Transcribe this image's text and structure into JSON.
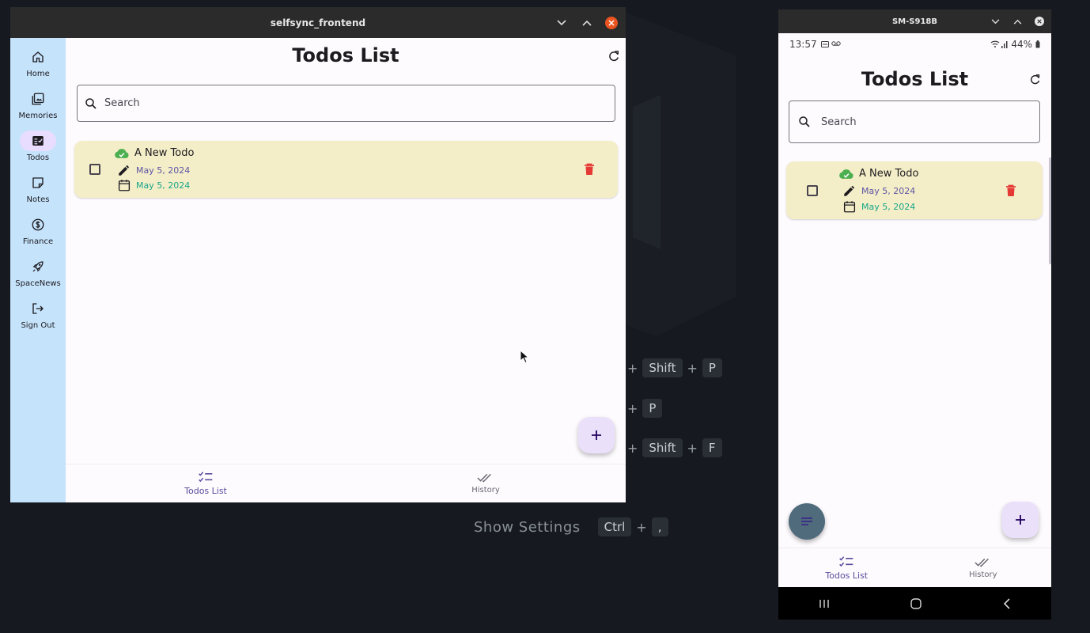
{
  "background": {
    "shortcuts": [
      {
        "keys": [
          "Shift",
          "P"
        ]
      },
      {
        "keys": [
          "P"
        ]
      },
      {
        "keys": [
          "Shift",
          "F"
        ]
      }
    ],
    "show_settings": {
      "label": "Show Settings",
      "keys": [
        "Ctrl",
        ","
      ]
    },
    "plus": "+"
  },
  "desktop": {
    "window_title": "selfsync_frontend",
    "rail": [
      {
        "label": "Home",
        "icon": "home-icon"
      },
      {
        "label": "Memories",
        "icon": "photo-library-icon"
      },
      {
        "label": "Todos",
        "icon": "fact-check-icon",
        "active": true
      },
      {
        "label": "Notes",
        "icon": "note-icon"
      },
      {
        "label": "Finance",
        "icon": "dollar-icon"
      },
      {
        "label": "SpaceNews",
        "icon": "rocket-icon"
      },
      {
        "label": "Sign Out",
        "icon": "logout-icon"
      }
    ],
    "page_title": "Todos List",
    "search_placeholder": "Search",
    "todos": [
      {
        "title": "A New Todo",
        "edited": "May 5, 2024",
        "due": "May 5, 2024",
        "synced": true,
        "completed": false
      }
    ],
    "bottom_nav": [
      {
        "label": "Todos List",
        "icon": "checklist-icon",
        "active": true
      },
      {
        "label": "History",
        "icon": "done-all-icon",
        "active": false
      }
    ]
  },
  "phone": {
    "window_title": "SM-S918B",
    "status_time": "13:57",
    "battery": "44%",
    "page_title": "Todos List",
    "search_placeholder": "Search",
    "todos": [
      {
        "title": "A New Todo",
        "edited": "May 5, 2024",
        "due": "May 5, 2024",
        "synced": true,
        "completed": false
      }
    ],
    "bottom_nav": [
      {
        "label": "Todos List",
        "icon": "checklist-icon",
        "active": true
      },
      {
        "label": "History",
        "icon": "done-all-icon",
        "active": false
      }
    ]
  },
  "colors": {
    "rail_bg": "#c5e3fb",
    "card_bg": "#f4eec8",
    "accent": "#5a4b9c",
    "due_date": "#17a589",
    "delete": "#e53935",
    "cloud_ok": "#4caf50",
    "close_orange": "#e95420"
  }
}
